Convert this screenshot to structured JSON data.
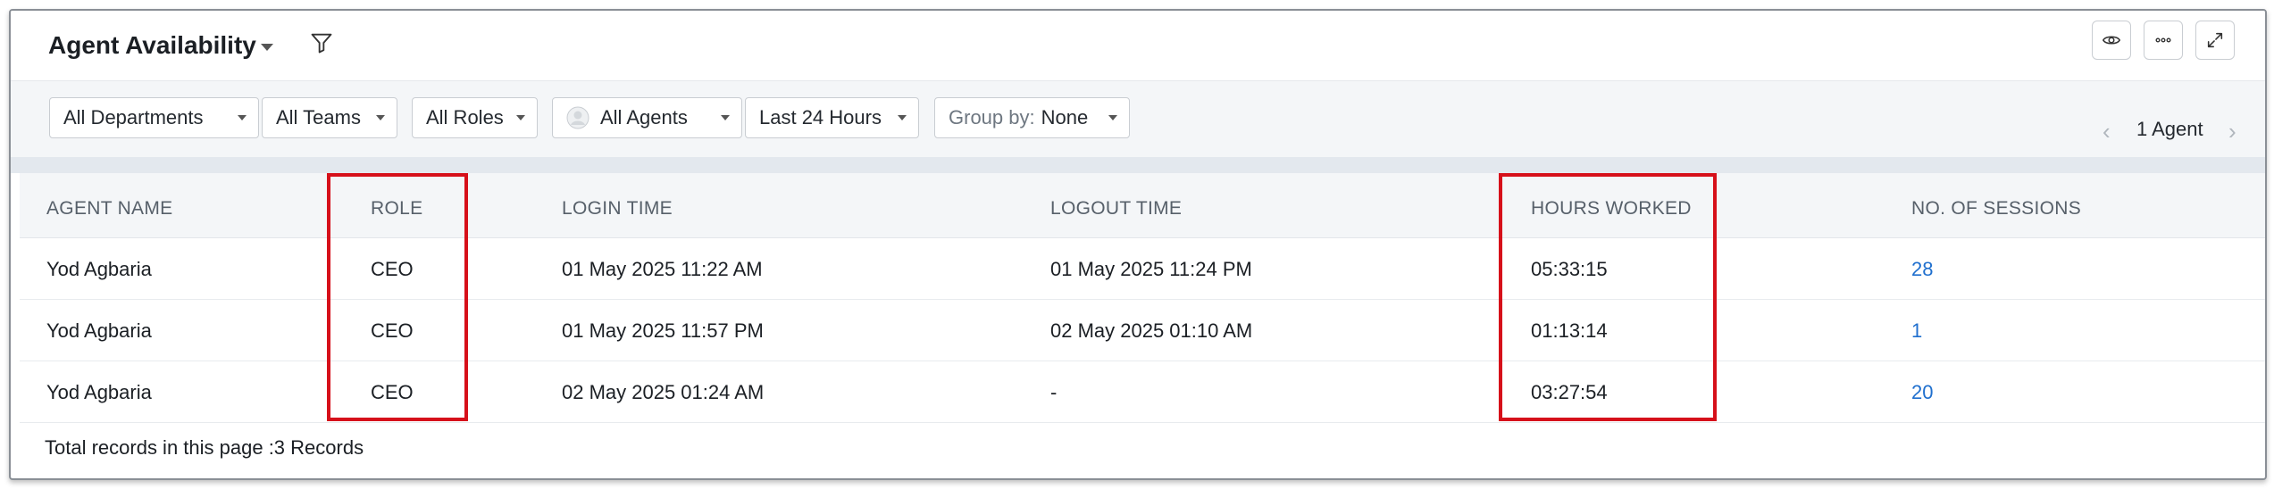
{
  "header": {
    "title": "Agent Availability",
    "icons": [
      "filter-icon",
      "eye-icon",
      "more-icon",
      "expand-icon"
    ]
  },
  "toolbar": {
    "filters": [
      {
        "label": "All Departments"
      },
      {
        "label": "All Teams"
      },
      {
        "label": "All Roles"
      },
      {
        "label": "All Agents",
        "icon": "avatar-icon"
      },
      {
        "label": "Last 24 Hours"
      }
    ],
    "group_by": {
      "prefix": "Group by:",
      "value": "None"
    },
    "pager": {
      "text": "1 Agent"
    }
  },
  "table": {
    "columns": [
      "AGENT NAME",
      "ROLE",
      "LOGIN TIME",
      "LOGOUT TIME",
      "HOURS WORKED",
      "NO. OF SESSIONS"
    ],
    "rows": [
      {
        "agent": "Yod Agbaria",
        "role": "CEO",
        "login": "01 May 2025 11:22 AM",
        "logout": "01 May 2025 11:24 PM",
        "hours": "05:33:15",
        "sessions": "28"
      },
      {
        "agent": "Yod Agbaria",
        "role": "CEO",
        "login": "01 May 2025 11:57 PM",
        "logout": "02 May 2025 01:10 AM",
        "hours": "01:13:14",
        "sessions": "1"
      },
      {
        "agent": "Yod Agbaria",
        "role": "CEO",
        "login": "02 May 2025 01:24 AM",
        "logout": "-",
        "hours": "03:27:54",
        "sessions": "20"
      }
    ]
  },
  "footer": {
    "text": "Total records in this page :3 Records"
  },
  "colors": {
    "link": "#1f6fce",
    "highlight": "#d6101a",
    "header_bg": "#f4f6f8"
  }
}
